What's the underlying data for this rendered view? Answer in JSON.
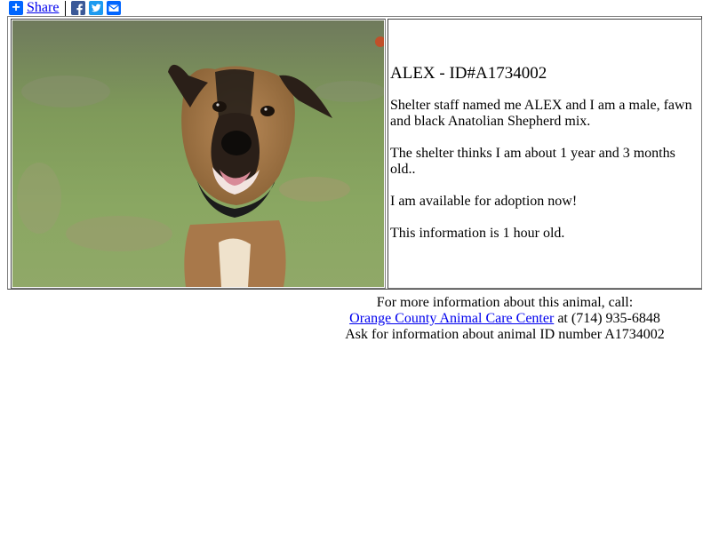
{
  "share": {
    "label": "Share",
    "icons": [
      "plus-icon",
      "facebook-icon",
      "twitter-icon",
      "email-icon"
    ]
  },
  "colors": {
    "link": "#0000ee",
    "share_blue": "#0166ff",
    "facebook": "#3b5998",
    "twitter": "#1d9bf0"
  },
  "animal": {
    "title": "ALEX - ID#A1734002",
    "description": "Shelter staff named me ALEX and I am a male, fawn and black Anatolian Shepherd mix.",
    "age": "The shelter thinks I am about 1 year and 3 months old..",
    "availability": "I am available for adoption now!",
    "freshness": "This information is 1 hour old."
  },
  "contact": {
    "line1": "For more information about this animal, call:",
    "shelter_name": "Orange County Animal Care Center",
    "phone_text": " at (714) 935-6848",
    "line3": "Ask for information about animal ID number A1734002"
  }
}
